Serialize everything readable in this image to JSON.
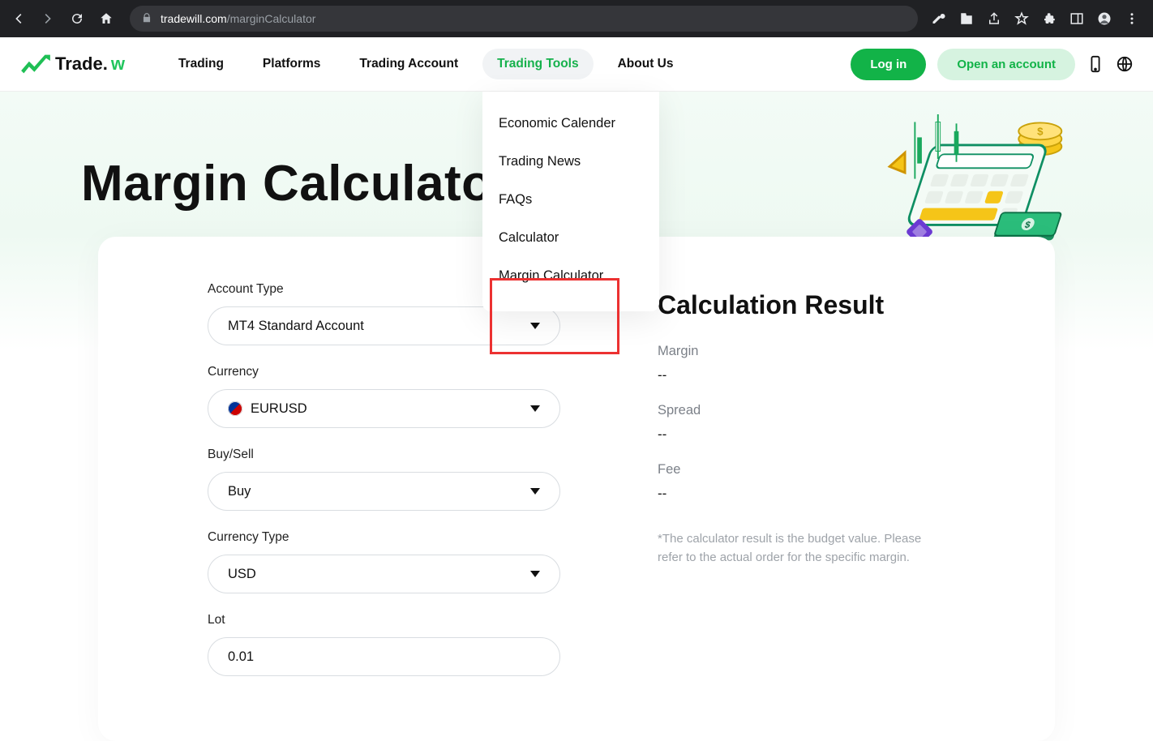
{
  "chrome": {
    "url_domain": "tradewill.com",
    "url_path": "/marginCalculator"
  },
  "header": {
    "logo_text": "Trade.",
    "logo_suffix": "w",
    "nav": [
      "Trading",
      "Platforms",
      "Trading Account",
      "Trading Tools",
      "About Us"
    ],
    "active_nav_index": 3,
    "login": "Log in",
    "open_account": "Open an account"
  },
  "dropdown": {
    "items": [
      "Economic Calender",
      "Trading News",
      "FAQs",
      "Calculator",
      "Margin Calculator"
    ],
    "boxed_start": 3,
    "boxed_end": 4
  },
  "page": {
    "title": "Margin Calculator"
  },
  "form": {
    "account_type": {
      "label": "Account Type",
      "value": "MT4 Standard Account"
    },
    "currency": {
      "label": "Currency",
      "value": "EURUSD"
    },
    "buy_sell": {
      "label": "Buy/Sell",
      "value": "Buy"
    },
    "currency_type": {
      "label": "Currency Type",
      "value": "USD"
    },
    "lot": {
      "label": "Lot",
      "value": "0.01"
    }
  },
  "result": {
    "title": "Calculation Result",
    "margin_label": "Margin",
    "margin_value": "--",
    "spread_label": "Spread",
    "spread_value": "--",
    "fee_label": "Fee",
    "fee_value": "--",
    "disclaimer": "*The calculator result is the budget value. Please refer to the actual order for the specific margin."
  }
}
